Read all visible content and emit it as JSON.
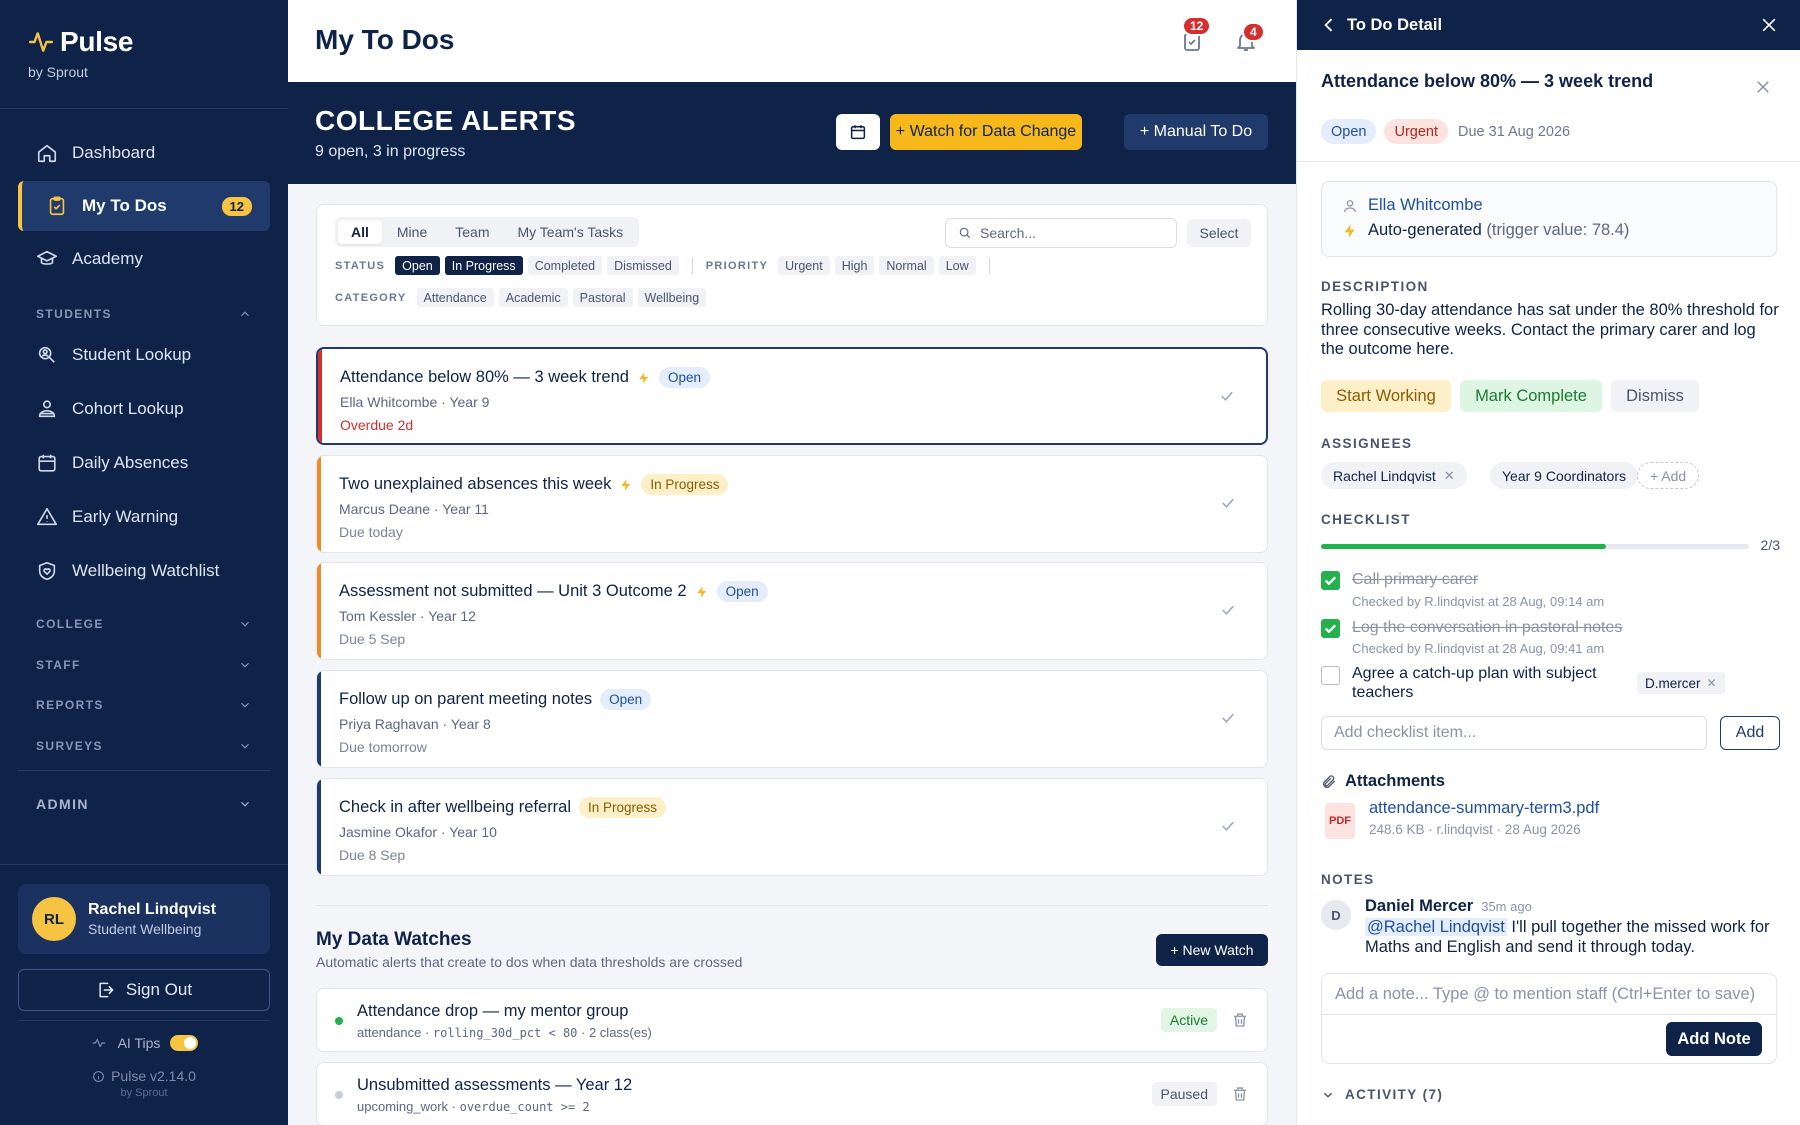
{
  "sidebar": {
    "brand": "Pulse",
    "brand_sub": "by Sprout",
    "nav": [
      {
        "label": "Dashboard",
        "icon": "home-icon"
      },
      {
        "label": "My To Dos",
        "icon": "clipboard-check-icon",
        "badge": "12",
        "active": true
      },
      {
        "label": "Academy",
        "icon": "graduation-cap-icon"
      }
    ],
    "students_head": "STUDENTS",
    "students": [
      {
        "label": "Student Lookup",
        "icon": "user-search-icon"
      },
      {
        "label": "Cohort Lookup",
        "icon": "users-icon"
      },
      {
        "label": "Daily Absences",
        "icon": "calendar-icon"
      },
      {
        "label": "Early Warning",
        "icon": "warning-triangle-icon"
      },
      {
        "label": "Wellbeing Watchlist",
        "icon": "shield-heart-icon"
      }
    ],
    "sections": [
      "COLLEGE",
      "STAFF",
      "REPORTS",
      "SURVEYS"
    ],
    "admin": "ADMIN",
    "user": {
      "initials": "RL",
      "name": "Rachel Lindqvist",
      "role": "Student Wellbeing"
    },
    "sign_out": "Sign Out",
    "ai_tips": "AI Tips",
    "version": "Pulse v2.14.0",
    "version_sub": "by Sprout"
  },
  "header": {
    "title": "My To Dos",
    "todo_badge": "12",
    "notif_badge": "4"
  },
  "hero": {
    "title": "COLLEGE ALERTS",
    "subtitle": "9 open, 3 in progress",
    "watch_btn": "+ Watch for Data Change",
    "manual_btn": "+ Manual To Do"
  },
  "filters": {
    "tabs": [
      "All",
      "Mine",
      "Team",
      "My Team's Tasks"
    ],
    "search_placeholder": "Search...",
    "select": "Select",
    "status_label": "STATUS",
    "status": [
      {
        "label": "Open",
        "on": true
      },
      {
        "label": "In Progress",
        "on": true
      },
      {
        "label": "Completed",
        "on": false
      },
      {
        "label": "Dismissed",
        "on": false
      }
    ],
    "priority_label": "PRIORITY",
    "priority": [
      "Urgent",
      "High",
      "Normal",
      "Low"
    ],
    "category_label": "CATEGORY",
    "category": [
      "Attendance",
      "Academic",
      "Pastoral",
      "Wellbeing"
    ]
  },
  "todos": [
    {
      "title": "Attendance below 80% — 3 week trend",
      "auto": true,
      "status": "Open",
      "meta": "Ella Whitcombe · Year 9",
      "due": "Overdue 2d",
      "bar": "#d32f2f",
      "overdue": true
    },
    {
      "title": "Two unexplained absences this week",
      "auto": true,
      "status": "In Progress",
      "meta": "Marcus Deane · Year 11",
      "due": "Due today",
      "bar": "#f08a24",
      "overdue": false
    },
    {
      "title": "Assessment not submitted — Unit 3 Outcome 2",
      "auto": true,
      "status": "Open",
      "meta": "Tom Kessler · Year 12",
      "due": "Due 5 Sep",
      "bar": "#f08a24",
      "overdue": false
    },
    {
      "title": "Follow up on parent meeting notes",
      "auto": false,
      "status": "Open",
      "meta": "Priya Raghavan · Year 8",
      "due": "Due tomorrow",
      "bar": "#1f3a6b",
      "overdue": false
    },
    {
      "title": "Check in after wellbeing referral",
      "auto": false,
      "status": "In Progress",
      "meta": "Jasmine Okafor · Year 10",
      "due": "Due 8 Sep",
      "bar": "#1f3a6b",
      "overdue": false
    }
  ],
  "watches": {
    "title": "My Data Watches",
    "subtitle": "Automatic alerts that create to dos when data thresholds are crossed",
    "new_btn": "+ New Watch",
    "items": [
      {
        "name": "Attendance drop — my mentor group",
        "source": "attendance",
        "expr": "rolling_30d_pct < 80",
        "scope": "2 class(es)",
        "status": "Active",
        "dot": "#22b14c"
      },
      {
        "name": "Unsubmitted assessments — Year 12",
        "source": "upcoming_work",
        "expr": "overdue_count >= 2",
        "scope": "",
        "status": "Paused",
        "dot": "#c2c8d3"
      }
    ]
  },
  "detail": {
    "header": "To Do Detail",
    "title": "Attendance below 80% — 3 week trend",
    "tag_open": "Open",
    "tag_urgent": "Urgent",
    "due": "Due 31 Aug 2026",
    "student": "Ella Whitcombe",
    "auto_label": "Auto-generated",
    "trigger": "(trigger value: 78.4)",
    "desc_label": "DESCRIPTION",
    "description": "Rolling 30-day attendance has sat under the 80% threshold for three consecutive weeks. Contact the primary carer and log the outcome here.",
    "btn_start": "Start Working",
    "btn_complete": "Mark Complete",
    "btn_dismiss": "Dismiss",
    "assignees_label": "ASSIGNEES",
    "assignees": [
      "Rachel Lindqvist",
      "Year 9 Coordinators"
    ],
    "add_assignee": "+ Add",
    "checklist_label": "CHECKLIST",
    "checklist_progress": 0.667,
    "checklist_count": "2/3",
    "checklist": [
      {
        "text": "Call primary carer",
        "done": true,
        "sub": "Checked by R.lindqvist at 28 Aug, 09:14 am"
      },
      {
        "text": "Log the conversation in pastoral notes",
        "done": true,
        "sub": "Checked by R.lindqvist at 28 Aug, 09:41 am"
      },
      {
        "text": "Agree a catch-up plan with subject teachers",
        "done": false,
        "assignee": "D.mercer"
      }
    ],
    "checklist_placeholder": "Add checklist item...",
    "checklist_add": "Add",
    "attachments_label": "Attachments",
    "attachment_type": "PDF",
    "attachment_name": "attendance-summary-term3.pdf",
    "attachment_meta": "248.6 KB · r.lindqvist · 28 Aug 2026",
    "notes_label": "NOTES",
    "note": {
      "initial": "D",
      "author": "Daniel Mercer",
      "time": "35m ago",
      "mention": "@Rachel Lindqvist",
      "text": " I'll pull together the missed work for Maths and English and send it through today."
    },
    "note_placeholder": "Add a note... Type @ to mention staff (Ctrl+Enter to save)",
    "add_note": "Add Note",
    "activity": "ACTIVITY (7)"
  }
}
